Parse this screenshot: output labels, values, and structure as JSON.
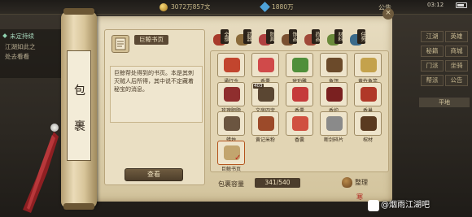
{
  "status_bar": {
    "copper": "3072万857文",
    "silver": "1880万",
    "gold": "",
    "notice": "公告",
    "clock": "03:12"
  },
  "left_panel": {
    "task_title": "未定持续",
    "lines": [
      "江湖如此之",
      "处去看看"
    ]
  },
  "right_panel": {
    "buttons": [
      "江湖",
      "英雄",
      "秘籍",
      "商城",
      "门派",
      "坐骑",
      "帮派",
      "公告"
    ],
    "area_label": "平地"
  },
  "scroll": {
    "title_chars": [
      "包",
      "裹"
    ],
    "close": "×"
  },
  "detail": {
    "item_name": "巨鲸书页",
    "description": "巨鲸帮处得到的书页。本是其刺灭贼人后所得，其中说不定藏着秘宝的消息。",
    "view_button": "查看",
    "icon": "book-page-icon"
  },
  "tabs": [
    {
      "label": "全部",
      "icon": "all-items-icon",
      "color": "#a83a2a"
    },
    {
      "label": "武器",
      "icon": "weapon-icon",
      "color": "#8a6a3a"
    },
    {
      "label": "防具",
      "icon": "armor-icon",
      "color": "#b04040"
    },
    {
      "label": "饰品",
      "icon": "accessory-icon",
      "color": "#7a5030"
    },
    {
      "label": "药品",
      "icon": "medicine-icon",
      "color": "#a04838"
    },
    {
      "label": "材料",
      "icon": "material-icon",
      "color": "#6a8a3a"
    },
    {
      "label": "任务",
      "icon": "task-icon",
      "color": "#3a6a8a"
    }
  ],
  "items": [
    {
      "label": "通行令",
      "count": "",
      "icon": "token-icon",
      "color": "#c2452e"
    },
    {
      "label": "香囊",
      "count": "",
      "icon": "sachet-icon",
      "color": "#d04a4a"
    },
    {
      "label": "琥珀雕",
      "count": "",
      "icon": "amber-icon",
      "color": "#4f8f3a"
    },
    {
      "label": "鱼饵",
      "count": "",
      "icon": "bait-icon",
      "color": "#6b4a2a"
    },
    {
      "label": "黄竹鱼竿",
      "count": "",
      "icon": "fishing-rod-icon",
      "color": "#c4a24c"
    },
    {
      "label": "玫瑰胭脂",
      "count": "",
      "icon": "rouge-icon",
      "color": "#8f2e2e"
    },
    {
      "label": "文房四宝",
      "count": "403",
      "icon": "stationery-icon",
      "color": "#5a4632"
    },
    {
      "label": "香囊",
      "count": "",
      "icon": "sachet-icon",
      "color": "#c53a3a"
    },
    {
      "label": "香炉",
      "count": "",
      "icon": "censer-icon",
      "color": "#7a2020"
    },
    {
      "label": "香巢",
      "count": "",
      "icon": "nest-icon",
      "color": "#b03828"
    },
    {
      "label": "蜡烛",
      "count": "",
      "icon": "candle-icon",
      "color": "#6b5540"
    },
    {
      "label": "黄记米粉",
      "count": "",
      "icon": "rice-noodle-icon",
      "color": "#9c4a2a"
    },
    {
      "label": "香囊",
      "count": "",
      "icon": "sachet-icon",
      "color": "#d05040"
    },
    {
      "label": "断剑碎片",
      "count": "",
      "icon": "sword-shard-icon",
      "color": "#8a8a8a"
    },
    {
      "label": "棺材",
      "count": "",
      "icon": "coffin-icon",
      "color": "#5a3a20"
    },
    {
      "label": "巨鲸书页",
      "count": "",
      "icon": "book-page-icon",
      "color": "#c2a56e",
      "selected": true
    }
  ],
  "footer": {
    "capacity_label": "包裹容量",
    "capacity_value": "341/540",
    "sort_button": "整理",
    "seal": "寒"
  },
  "watermark": {
    "text": "@烟雨江湖吧"
  }
}
